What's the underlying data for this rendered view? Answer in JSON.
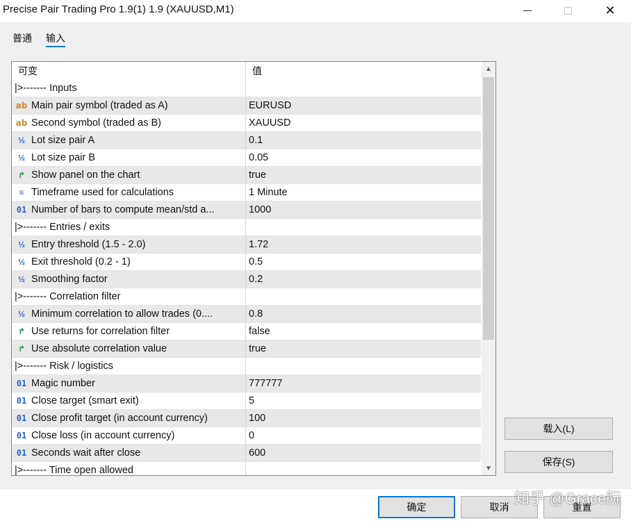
{
  "window": {
    "title": "Precise Pair Trading Pro 1.9(1) 1.9 (XAUUSD,M1)",
    "close_glyph": "✕"
  },
  "tabs": [
    {
      "label": "普通"
    },
    {
      "label": "输入"
    }
  ],
  "grid": {
    "columns": [
      "可变",
      "值"
    ],
    "rows": [
      {
        "name": "|>------- Inputs",
        "value": "",
        "icon": "none"
      },
      {
        "name": "Main pair symbol (traded as A)",
        "value": "EURUSD",
        "icon": "ab"
      },
      {
        "name": "Second symbol (traded as B)",
        "value": "XAUUSD",
        "icon": "ab"
      },
      {
        "name": "Lot size pair A",
        "value": "0.1",
        "icon": "half"
      },
      {
        "name": "Lot size pair B",
        "value": "0.05",
        "icon": "half"
      },
      {
        "name": "Show panel on the chart",
        "value": "true",
        "icon": "bool"
      },
      {
        "name": "Timeframe used for calculations",
        "value": "1 Minute",
        "icon": "enum"
      },
      {
        "name": "Number of bars to compute mean/std a...",
        "value": "1000",
        "icon": "int"
      },
      {
        "name": "|>------- Entries / exits",
        "value": "",
        "icon": "none"
      },
      {
        "name": "Entry threshold (1.5 - 2.0)",
        "value": "1.72",
        "icon": "half"
      },
      {
        "name": "Exit threshold (0.2 - 1)",
        "value": "0.5",
        "icon": "half"
      },
      {
        "name": "Smoothing factor",
        "value": "0.2",
        "icon": "half"
      },
      {
        "name": "|>------- Correlation filter",
        "value": "",
        "icon": "none"
      },
      {
        "name": "Minimum correlation to allow trades (0....",
        "value": "0.8",
        "icon": "half"
      },
      {
        "name": "Use returns for correlation filter",
        "value": "false",
        "icon": "bool"
      },
      {
        "name": "Use absolute correlation value",
        "value": "true",
        "icon": "bool"
      },
      {
        "name": "|>------- Risk / logistics",
        "value": "",
        "icon": "none"
      },
      {
        "name": "Magic number",
        "value": "777777",
        "icon": "int"
      },
      {
        "name": "Close target (smart exit)",
        "value": "5",
        "icon": "int"
      },
      {
        "name": "Close profit target (in account currency)",
        "value": "100",
        "icon": "int"
      },
      {
        "name": "Close loss (in account currency)",
        "value": "0",
        "icon": "int"
      },
      {
        "name": "Seconds wait after close",
        "value": "600",
        "icon": "int"
      },
      {
        "name": "|>------- Time open allowed",
        "value": "",
        "icon": "none"
      }
    ]
  },
  "buttons": {
    "load": "载入(L)",
    "save": "保存(S)",
    "ok": "确定",
    "cancel": "取消",
    "reset": "重置"
  },
  "watermark": "知乎 @Grace阮",
  "icon_glyphs": {
    "ab": "ab",
    "half": "½",
    "bool": "↱",
    "enum": "≡",
    "int": "01",
    "none": ""
  }
}
